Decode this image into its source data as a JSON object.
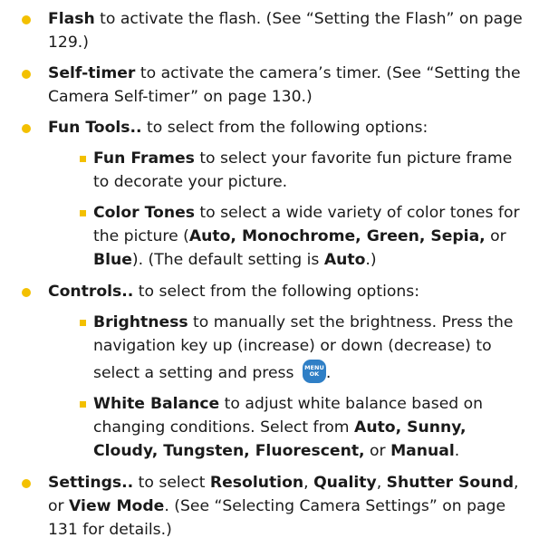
{
  "colors": {
    "bullet": "#f3c000",
    "menu_button": "#2f7fc6",
    "text": "#1a1a1a"
  },
  "items": {
    "flash": {
      "term": "Flash",
      "text": " to activate the flash. (See “Setting the Flash” on page 129.)"
    },
    "selftimer": {
      "term": "Self-timer",
      "text": " to activate the camera’s timer. (See “Setting the Camera Self-timer” on page 130.)"
    },
    "funtools": {
      "term": "Fun Tools..",
      "text": " to select from the following options:",
      "sub": {
        "frames": {
          "term": "Fun Frames",
          "text": " to select your favorite fun picture frame to decorate your picture."
        },
        "tones": {
          "term": "Color Tones",
          "text1": " to select a wide variety of color tones for the picture (",
          "options": "Auto, Monochrome, Green, Sepia,",
          "or": " or ",
          "blue": "Blue",
          "text2": "). (The default setting is ",
          "default": "Auto",
          "text3": ".)"
        }
      }
    },
    "controls": {
      "term": "Controls..",
      "text": " to select from the following options:",
      "sub": {
        "brightness": {
          "term": "Brightness",
          "text1": " to manually set the brightness. Press the navigation key up (increase) or down (decrease) to",
          "text2": "select a setting and press ",
          "button_top": "MENU",
          "button_bottom": "OK",
          "text3": "."
        },
        "whitebalance": {
          "term": "White Balance",
          "text1": " to adjust white balance based on changing conditions. Select from ",
          "options": "Auto, Sunny, Cloudy, Tungsten, Fluorescent,",
          "or": " or ",
          "manual": "Manual",
          "text2": "."
        }
      }
    },
    "settings": {
      "term": "Settings..",
      "text1": " to select ",
      "res": "Resolution",
      "c1": ", ",
      "quality": "Quality",
      "c2": ", ",
      "shutter": "Shutter Sound",
      "c3": ", or ",
      "view": "View Mode",
      "text2": ". (See “Selecting Camera Settings” on page 131 for details.)"
    }
  }
}
